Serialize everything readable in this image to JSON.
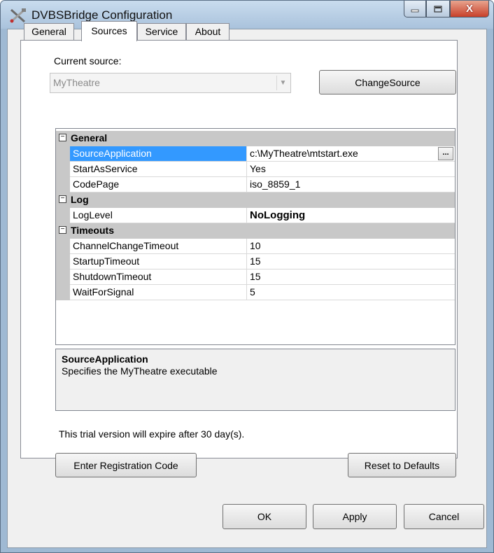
{
  "window": {
    "title": "DVBSBridge Configuration",
    "controls": {
      "minimize": "–",
      "maximize": "□",
      "close": "X"
    }
  },
  "tabs": [
    {
      "label": "General",
      "active": false
    },
    {
      "label": "Sources",
      "active": true
    },
    {
      "label": "Service",
      "active": false
    },
    {
      "label": "About",
      "active": false
    }
  ],
  "source": {
    "label": "Current source:",
    "value": "MyTheatre",
    "change_button": "ChangeSource"
  },
  "property_grid": {
    "categories": [
      {
        "name": "General",
        "properties": [
          {
            "name": "SourceApplication",
            "value": "c:\\MyTheatre\\mtstart.exe",
            "selected": true
          },
          {
            "name": "StartAsService",
            "value": "Yes"
          },
          {
            "name": "CodePage",
            "value": "iso_8859_1"
          }
        ]
      },
      {
        "name": "Log",
        "properties": [
          {
            "name": "LogLevel",
            "value": "NoLogging"
          }
        ]
      },
      {
        "name": "Timeouts",
        "properties": [
          {
            "name": "ChannelChangeTimeout",
            "value": "10"
          },
          {
            "name": "StartupTimeout",
            "value": "15"
          },
          {
            "name": "ShutdownTimeout",
            "value": "15"
          },
          {
            "name": "WaitForSignal",
            "value": "5"
          }
        ]
      }
    ],
    "collapse_glyph": "⊟",
    "ellipsis": "...",
    "help_title": "SourceApplication",
    "help_description": "Specifies the MyTheatre executable"
  },
  "trial_text": "This trial version will expire after 30 day(s).",
  "buttons": {
    "register": "Enter Registration Code",
    "reset": "Reset to Defaults",
    "ok": "OK",
    "apply": "Apply",
    "cancel": "Cancel"
  },
  "colors": {
    "selection": "#3399ff",
    "category_band": "#c8c8c8",
    "frame": "#9fb9d3",
    "close_button": "#c8402a"
  }
}
